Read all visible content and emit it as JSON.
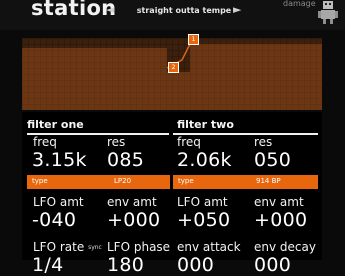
{
  "header": {
    "title": "station",
    "preset": "straight outta tempe",
    "prev_icon": "◄",
    "next_icon": "►",
    "brand": "damage"
  },
  "graph": {
    "node1": "1",
    "node2": "2"
  },
  "filter_one": {
    "heading": "filter one",
    "freq_label": "freq",
    "freq_value": "3.15k",
    "res_label": "res",
    "res_value": "085",
    "type_label": "type",
    "type_value": "LP20",
    "lfo_amt_label": "LFO amt",
    "lfo_amt_value": "-040",
    "env_amt_label": "env amt",
    "env_amt_value": "+000",
    "lfo_rate_label": "LFO rate",
    "sync_label": "sync",
    "lfo_rate_value": "1/4",
    "lfo_phase_label": "LFO phase",
    "lfo_phase_value": "180"
  },
  "filter_two": {
    "heading": "filter two",
    "freq_label": "freq",
    "freq_value": "2.06k",
    "res_label": "res",
    "res_value": "050",
    "type_label": "type",
    "type_value": "914 BP",
    "lfo_amt_label": "LFO amt",
    "lfo_amt_value": "+050",
    "env_amt_label": "env amt",
    "env_amt_value": "+000",
    "env_attack_label": "env attack",
    "env_attack_value": "000",
    "env_decay_label": "env decay",
    "env_decay_value": "000"
  },
  "colors": {
    "accent": "#e8670e",
    "graph_bg": "#1c120c"
  }
}
